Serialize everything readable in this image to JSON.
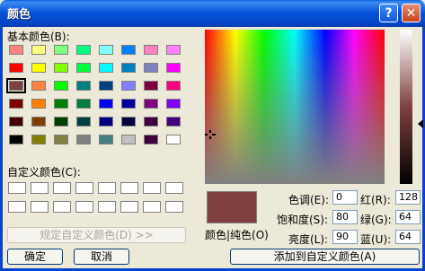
{
  "window": {
    "title": "颜色",
    "help_label": "?",
    "close_label": "✕"
  },
  "basic": {
    "label": "基本颜色(B):",
    "colors": [
      "#ff8080",
      "#ffff80",
      "#80ff80",
      "#00ff80",
      "#80ffff",
      "#0080ff",
      "#ff80c0",
      "#ff80ff",
      "#ff0000",
      "#ffff00",
      "#80ff00",
      "#00ff40",
      "#00ffff",
      "#0080c0",
      "#8080c0",
      "#ff00ff",
      "#804040",
      "#ff8040",
      "#00ff00",
      "#008080",
      "#004080",
      "#8080ff",
      "#800040",
      "#ff0080",
      "#800000",
      "#ff8000",
      "#008000",
      "#008040",
      "#0000ff",
      "#0000a0",
      "#800080",
      "#8000ff",
      "#400000",
      "#804000",
      "#004000",
      "#004040",
      "#000080",
      "#000040",
      "#400040",
      "#400080",
      "#000000",
      "#808000",
      "#808040",
      "#808080",
      "#408080",
      "#c0c0c0",
      "#400040",
      "#ffffff"
    ],
    "selected_index": 16
  },
  "custom": {
    "label": "自定义颜色(C):"
  },
  "buttons": {
    "define_custom": "规定自定义颜色(D) >>",
    "ok": "确定",
    "cancel": "取消",
    "add_custom": "添加到自定义颜色(A)"
  },
  "color_solid_label": "颜色|纯色(O)",
  "fields": {
    "hue": {
      "label": "色调(E):",
      "value": "0"
    },
    "sat": {
      "label": "饱和度(S):",
      "value": "80"
    },
    "lum": {
      "label": "亮度(L):",
      "value": "90"
    },
    "red": {
      "label": "红(R):",
      "value": "128"
    },
    "green": {
      "label": "绿(G):",
      "value": "64"
    },
    "blue": {
      "label": "蓝(U):",
      "value": "64"
    }
  },
  "current_color": "#804040"
}
